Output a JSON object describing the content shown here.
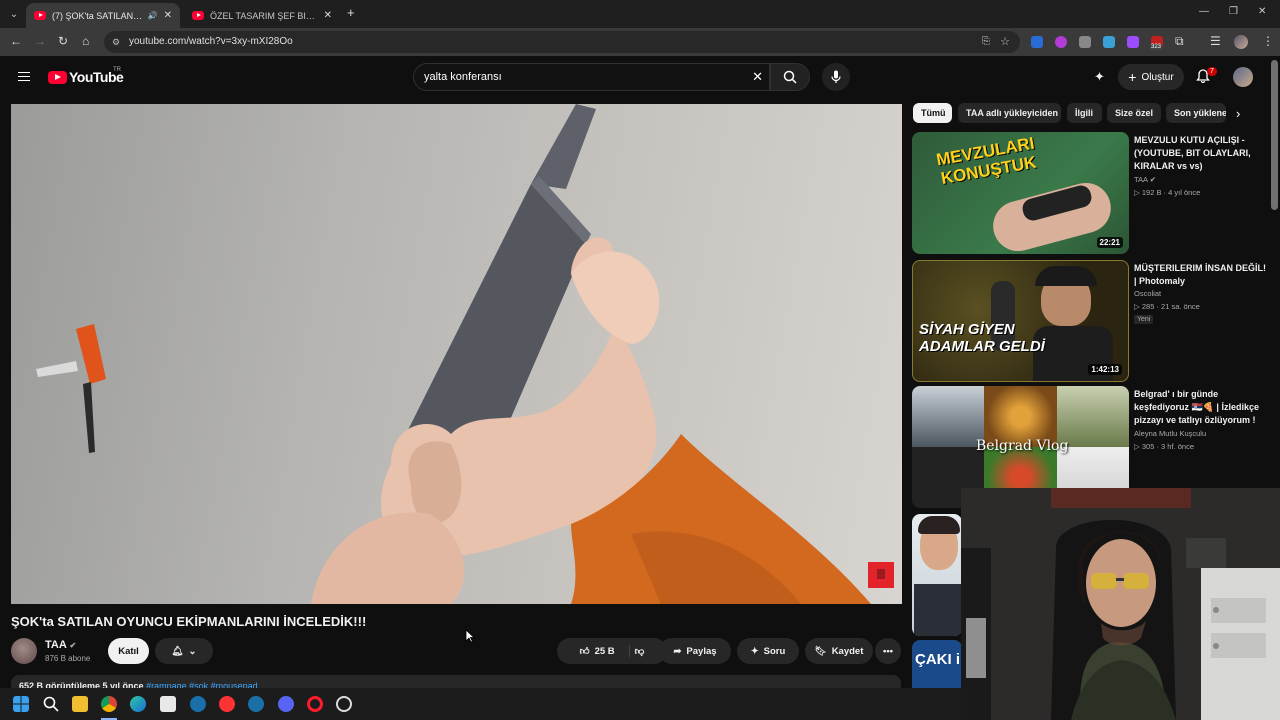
{
  "browser": {
    "tabs": [
      {
        "title": "(7) ŞOK'ta SATILAN OYUNC",
        "active": true
      },
      {
        "title": "ÖZEL TASARIM ŞEF BIÇAĞINI İN",
        "active": false
      }
    ],
    "new_tab": "+",
    "url": "youtube.com/watch?v=3xy-mXI28Oo",
    "extension_badge": "323"
  },
  "youtube": {
    "logo": "YouTube",
    "country_code": "TR",
    "search_query": "yalta konferansı",
    "create_label": "Oluştur",
    "notification_count": "7"
  },
  "video": {
    "title": "ŞOK'ta SATILAN OYUNCU EKİPMANLARINI İNCELEDİK!!!",
    "channel": "TAA",
    "subscribers": "876 B abone",
    "join_label": "Katıl",
    "likes": "25 B",
    "share_label": "Paylaş",
    "ask_label": "Soru",
    "save_label": "Kaydet",
    "views": "652 B görüntüleme",
    "age": "5 yıl önce",
    "tags": "#rampage #şok #mousepad"
  },
  "chips": [
    "Tümü",
    "TAA adlı yükleyiciden",
    "İlgili",
    "Size özel",
    "Son yüklenen"
  ],
  "related": [
    {
      "title": "MEVZULU KUTU AÇILIŞI - (YOUTUBE, BIT OLAYLARI, KIRALAR vs vs)",
      "channel": "TAA",
      "views": "192 B",
      "age": "4 yıl önce",
      "duration": "22:21",
      "thumb_text": "MEVZULARI KONUŞTUK",
      "verified": true
    },
    {
      "title": "MÜŞTERILERIM İNSAN DEĞİL! | Photomaly",
      "channel": "Oscoliat",
      "views": "285",
      "age": "21 sa. önce",
      "duration": "1:42:13",
      "thumb_text": "SİYAH GİYEN ADAMLAR GELDİ",
      "badge": "Yeni"
    },
    {
      "title": "Belgrad' ı bir günde keşfediyoruz 🇷🇸🍕 | İzledikçe pizzayı ve tatlıyı özlüyorum !",
      "channel": "Aleyna Mutlu Kuşculu",
      "views": "305",
      "age": "3 hf. önce",
      "thumb_text": "Belgrad Vlog"
    },
    {
      "thumb_text": ""
    },
    {
      "thumb_text": "ÇAKI iPHONE"
    }
  ],
  "colors": {
    "background": "#0f0f0f",
    "brand_red": "#ff0033",
    "link_blue": "#3ea6ff",
    "orange_shirt": "#d2691e"
  }
}
